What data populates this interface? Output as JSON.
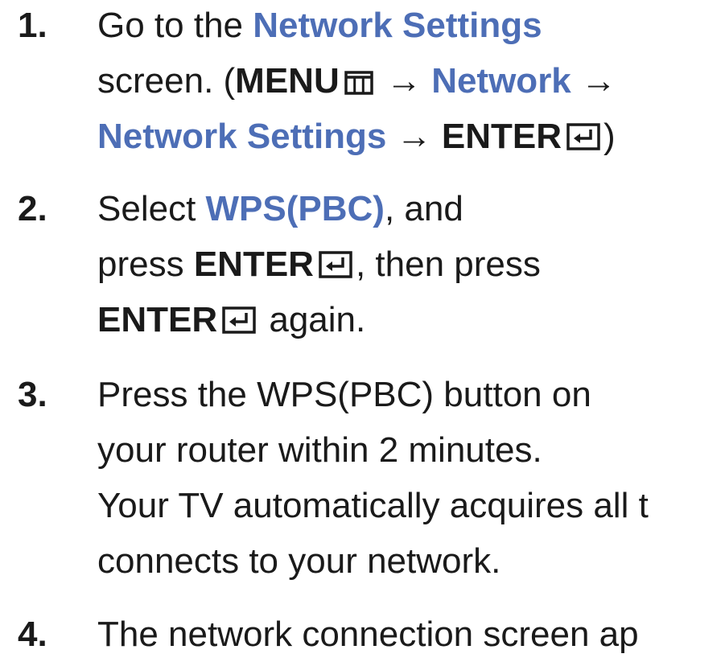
{
  "steps": [
    {
      "number": "1.",
      "lines": [
        [
          "Go to the ",
          "Network Settings"
        ],
        [
          "screen. (",
          "MENU",
          " → ",
          "Network",
          " →"
        ],
        [
          "Network Settings",
          " → ",
          "ENTER",
          ")"
        ]
      ]
    },
    {
      "number": "2.",
      "lines": [
        [
          "Select ",
          "WPS(PBC)",
          ", and"
        ],
        [
          "press ",
          "ENTER",
          ", then press"
        ],
        [
          "ENTER",
          " again."
        ]
      ]
    },
    {
      "number": "3.",
      "lines": [
        [
          "Press the WPS(PBC) button on"
        ],
        [
          "your router within 2 minutes."
        ],
        [
          "Your TV automatically acquires all t"
        ],
        [
          "connects to your network."
        ]
      ]
    },
    {
      "number": "4.",
      "lines": [
        [
          "The network connection screen ap"
        ]
      ]
    }
  ],
  "icons": {
    "menu": "menu-icon",
    "enter": "enter-icon"
  },
  "colors": {
    "highlight": "#4d6eb6",
    "text": "#1a1a1a"
  }
}
